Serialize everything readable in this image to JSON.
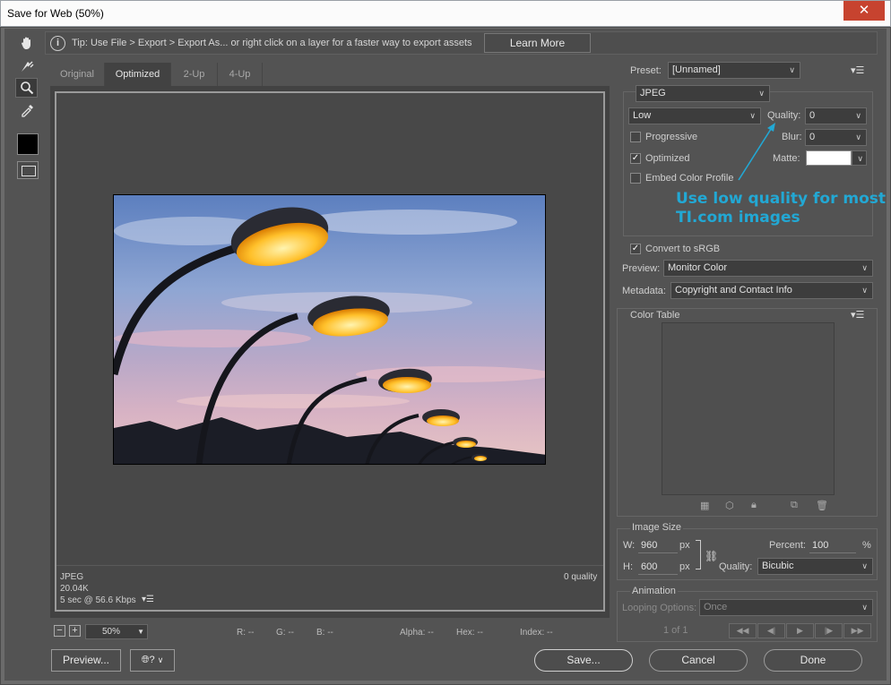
{
  "window": {
    "title": "Save for Web (50%)",
    "close_glyph": "✕"
  },
  "tools": [
    "hand-tool-icon",
    "slice-select-icon",
    "zoom-icon",
    "eyedropper-icon",
    "eyedropper-color",
    "toggle-slices-icon"
  ],
  "colors": {
    "eyedropper_color": "#000000",
    "matte": "#ffffff",
    "annotation": "#22a8d4"
  },
  "tip": {
    "text": "Tip: Use File > Export > Export As... or right click on a layer for a faster way to export assets",
    "button": "Learn More"
  },
  "tabs": [
    {
      "label": "Original",
      "active": false
    },
    {
      "label": "Optimized",
      "active": true
    },
    {
      "label": "2-Up",
      "active": false
    },
    {
      "label": "4-Up",
      "active": false
    }
  ],
  "image_status": {
    "format": "JPEG",
    "size": "20.04K",
    "download": "5 sec @ 56.6 Kbps",
    "quality": "0 quality"
  },
  "zoom": {
    "value": "50%"
  },
  "readouts": [
    "R: --",
    "G: --",
    "B: --",
    "Alpha: --",
    "Hex: --",
    "Index: --"
  ],
  "buttons": {
    "preview": "Preview...",
    "save": "Save...",
    "cancel": "Cancel",
    "done": "Done"
  },
  "settings": {
    "preset_label": "Preset:",
    "preset_value": "[Unnamed]",
    "format": "JPEG",
    "quality_level": "Low",
    "quality_label": "Quality:",
    "quality_value": "0",
    "blur_label": "Blur:",
    "blur_value": "0",
    "matte_label": "Matte:",
    "progressive": {
      "label": "Progressive",
      "checked": false
    },
    "optimized": {
      "label": "Optimized",
      "checked": true
    },
    "embed_profile": {
      "label": "Embed Color Profile",
      "checked": false
    },
    "convert_srgb": {
      "label": "Convert to sRGB",
      "checked": true
    },
    "preview_label": "Preview:",
    "preview_value": "Monitor Color",
    "metadata_label": "Metadata:",
    "metadata_value": "Copyright and Contact Info"
  },
  "annotation": {
    "line1": "Use low quality for most",
    "line2": "TI.com images"
  },
  "color_table": {
    "title": "Color Table"
  },
  "image_size": {
    "title": "Image Size",
    "w_label": "W:",
    "w_value": "960",
    "h_label": "H:",
    "h_value": "600",
    "unit": "px",
    "percent_label": "Percent:",
    "percent_value": "100",
    "percent_unit": "%",
    "quality_label": "Quality:",
    "quality_value": "Bicubic"
  },
  "animation": {
    "title": "Animation",
    "looping_label": "Looping Options:",
    "looping_value": "Once",
    "frame_counter": "1 of 1"
  }
}
